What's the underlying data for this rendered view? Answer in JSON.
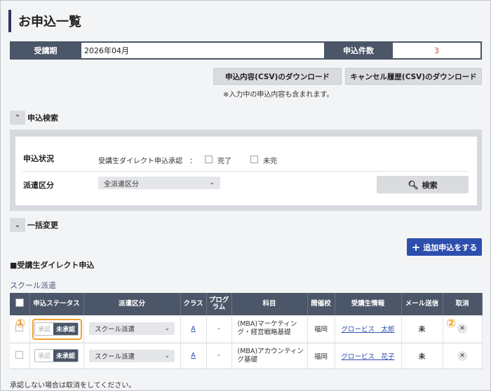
{
  "page": {
    "title": "お申込一覧"
  },
  "period": {
    "label": "受講期",
    "value": "2026年04月",
    "count_label": "申込件数",
    "count_value": "3"
  },
  "downloads": {
    "csv_label": "申込内容(CSV)のダウンロード",
    "cancel_csv_label": "キャンセル履歴(CSV)のダウンロード",
    "note": "※入力中の申込内容も含まれます。"
  },
  "search": {
    "toggle_label": "申込検索",
    "status_label": "申込状況",
    "direct_label": "受講生ダイレクト申込承認　：",
    "done_label": "完了",
    "undone_label": "未完",
    "dispatch_label": "派遣区分",
    "dispatch_value": "全派遣区分",
    "search_button": "検索"
  },
  "bulk": {
    "toggle_label": "一括変更"
  },
  "add_button": "追加申込をする",
  "section": {
    "heading": "■受講生ダイレクト申込",
    "school_heading": "スクール派遣"
  },
  "table": {
    "headers": [
      "",
      "申込ステータス",
      "派遣区分",
      "クラス",
      "プログラム",
      "科目",
      "開催校",
      "受講生情報",
      "メール送信",
      "取消"
    ],
    "rows": [
      {
        "status_off": "承認",
        "status_on": "未承認",
        "dispatch": "スクール派遣",
        "class": "A",
        "program": "-",
        "subject": "(MBA)マーケティング・経営戦略基礎",
        "school": "福岡",
        "student": "グロービス　太郎",
        "mail": "未"
      },
      {
        "status_off": "承認",
        "status_on": "未承認",
        "dispatch": "スクール派遣",
        "class": "A",
        "program": "-",
        "subject": "(MBA)アカウンティング基礎",
        "school": "福岡",
        "student": "グロービス　花子",
        "mail": "未"
      }
    ]
  },
  "annotations": {
    "marker1": "①",
    "marker2": "②"
  },
  "footer_note": "承認しない場合は取消をしてください。",
  "colors": {
    "header_bg": "#4b5668",
    "accent_blue": "#2c4fae",
    "highlight_orange": "#f0a12c",
    "count_red": "#e0482c"
  },
  "icons": {
    "expanded": "chevron-up-icon",
    "collapsed": "chevron-down-icon",
    "search": "search-icon",
    "add": "plus-icon",
    "cancel": "close-icon"
  }
}
